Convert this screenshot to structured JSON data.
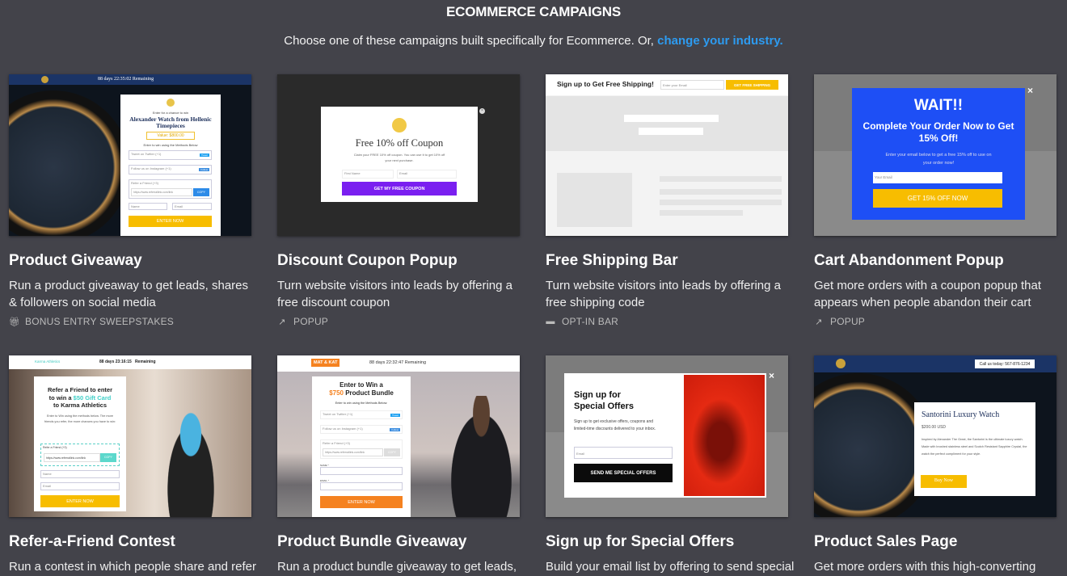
{
  "header": {
    "title": "ECOMMERCE CAMPAIGNS",
    "subtitle": "Choose one of these campaigns built specifically for Ecommerce. Or,",
    "link": "change your industry."
  },
  "colors": {
    "background": "#43434a",
    "link": "#2d9bf0",
    "yellow": "#f7bd00",
    "purple": "#7a1ff0",
    "blue": "#1e4ff5",
    "orange": "#f58220"
  },
  "cards": [
    {
      "title": "Product Giveaway",
      "desc": "Run a product giveaway to get leads, shares & followers on social media",
      "tag": "BONUS ENTRY SWEEPSTAKES",
      "tag_icon": "gift-icon",
      "preview": {
        "countdown": "88 days 22:35:02",
        "remaining": "Remaining",
        "intro": "Enter for a chance to win",
        "headline": "Alexander Watch from Hellenic Timepieces",
        "value": "Value: $800.00",
        "methods": "Enter to win using the Methods Below",
        "m1": "Tweet on Twitter (+1)",
        "m1b": "Tweet",
        "m2": "Follow us on Instagram (+1)",
        "m2b": "Follow",
        "m3": "Refer a Friend (+3)",
        "link": "https://www.referrallink.com/link",
        "copy": "COPY",
        "name": "Name",
        "email": "Email",
        "cta": "ENTER NOW"
      }
    },
    {
      "title": "Discount Coupon Popup",
      "desc": "Turn website visitors into leads by offering a free discount coupon",
      "tag": "POPUP",
      "tag_icon": "external-link-icon",
      "preview": {
        "headline": "Free 10% off Coupon",
        "body": "Claim your FREE 10% off coupon. You can use it to get 10% off your next purchase.",
        "first": "First Name",
        "email": "Email",
        "cta": "GET MY FREE COUPON"
      }
    },
    {
      "title": "Free Shipping Bar",
      "desc": "Turn website visitors into leads by offering a free shipping code",
      "tag": "OPT-IN BAR",
      "tag_icon": "minus-icon",
      "preview": {
        "headline": "Sign up to Get Free Shipping!",
        "email": "Enter your Email",
        "cta": "GET FREE SHIPPING"
      }
    },
    {
      "title": "Cart Abandonment Popup",
      "desc": "Get more orders with a coupon popup that appears when people abandon their cart",
      "tag": "POPUP",
      "tag_icon": "external-link-icon",
      "preview": {
        "wait": "WAIT!!",
        "headline": "Complete Your Order Now to Get 15% Off!",
        "body": "Enter your email below to get a free 15% off to use on your order now!",
        "email": "Your Email",
        "cta": "GET 15% OFF NOW"
      }
    },
    {
      "title": "Refer-a-Friend Contest",
      "desc": "Run a contest in which people share and refer",
      "preview": {
        "brand": "Karma Athletics",
        "countdown": "88 days 23:16:15",
        "remaining": "Remaining",
        "h1": "Refer a Friend to enter",
        "h2a": "to win a ",
        "h2b": "$50 Gift Card",
        "h3": "to Karma Athletics",
        "body": "Enter to Win using the methods below. The more friends you refer, the more chances you have to win:",
        "refer": "Refer a Friend (+3)",
        "link": "https://www.referrallink.com/link",
        "copy": "COPY",
        "name": "Name",
        "email": "Email",
        "cta": "ENTER NOW"
      }
    },
    {
      "title": "Product Bundle Giveaway",
      "desc": "Run a product bundle giveaway to get leads,",
      "preview": {
        "brand": "MAT & KAT",
        "countdown": "88 days 22:32:47",
        "remaining": "Remaining",
        "h1": "Enter to Win a",
        "h2a": "$750",
        "h2b": " Product Bundle",
        "methods": "Enter to win using the Methods Below:",
        "m1": "Tweet on Twitter (+1)",
        "m1b": "Tweet",
        "m2": "Follow us on Instagram (+1)",
        "m2b": "Follow",
        "m3": "Refer a Friend (+3)",
        "link": "https://www.referrallink.com/link",
        "copy": "COPY",
        "name": "NAME *",
        "email": "EMAIL *",
        "cta": "ENTER NOW"
      }
    },
    {
      "title": "Sign up for Special Offers",
      "desc": "Build your email list by offering to send special",
      "preview": {
        "headline": "Sign up for Special Offers",
        "body": "Sign up to get exclusive offers, coupons and limited-time discounts delivered to your inbox.",
        "email": "Email",
        "cta": "SEND ME SPECIAL OFFERS"
      }
    },
    {
      "title": "Product Sales Page",
      "desc": "Get more orders with this high-converting",
      "preview": {
        "call": "Call us today: 567-876-1234",
        "headline": "Santorini Luxury Watch",
        "price": "$200.00 USD",
        "body": "Inspired by Alexander The Great, the Santorini is the ultimate luxury watch. Made with brushed stainless steel and Scotch Resistant Sapphire Crystal, the watch the perfect compliment for your style.",
        "cta": "Buy Now"
      }
    }
  ]
}
